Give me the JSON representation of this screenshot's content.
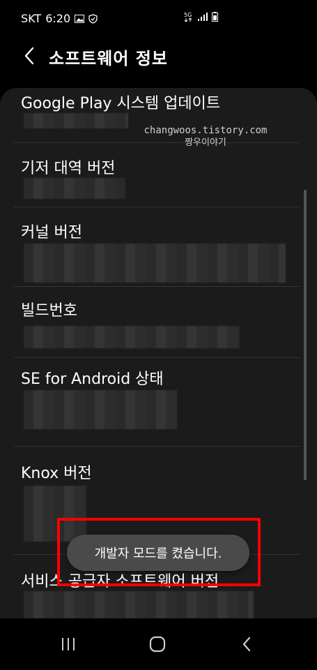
{
  "status_bar": {
    "carrier": "SKT",
    "time": "6:20",
    "network": "5G"
  },
  "header": {
    "title": "소프트웨어 정보"
  },
  "watermark": {
    "site": "changwoos.tistory.com",
    "name": "짱우이야기"
  },
  "list": {
    "items": [
      {
        "title": "Google Play 시스템 업데이트"
      },
      {
        "title": "기저 대역 버전"
      },
      {
        "title": "커널 버전"
      },
      {
        "title": "빌드번호"
      },
      {
        "title": "SE for Android 상태"
      },
      {
        "title": "Knox 버전"
      },
      {
        "title": "서비스 공급자 소프트웨어 버전"
      }
    ]
  },
  "toast": {
    "message": "개발자 모드를 켰습니다."
  },
  "colors": {
    "highlight": "#ff0000",
    "card_bg": "#1b1b1b",
    "toast_bg": "#4a4a4a"
  }
}
